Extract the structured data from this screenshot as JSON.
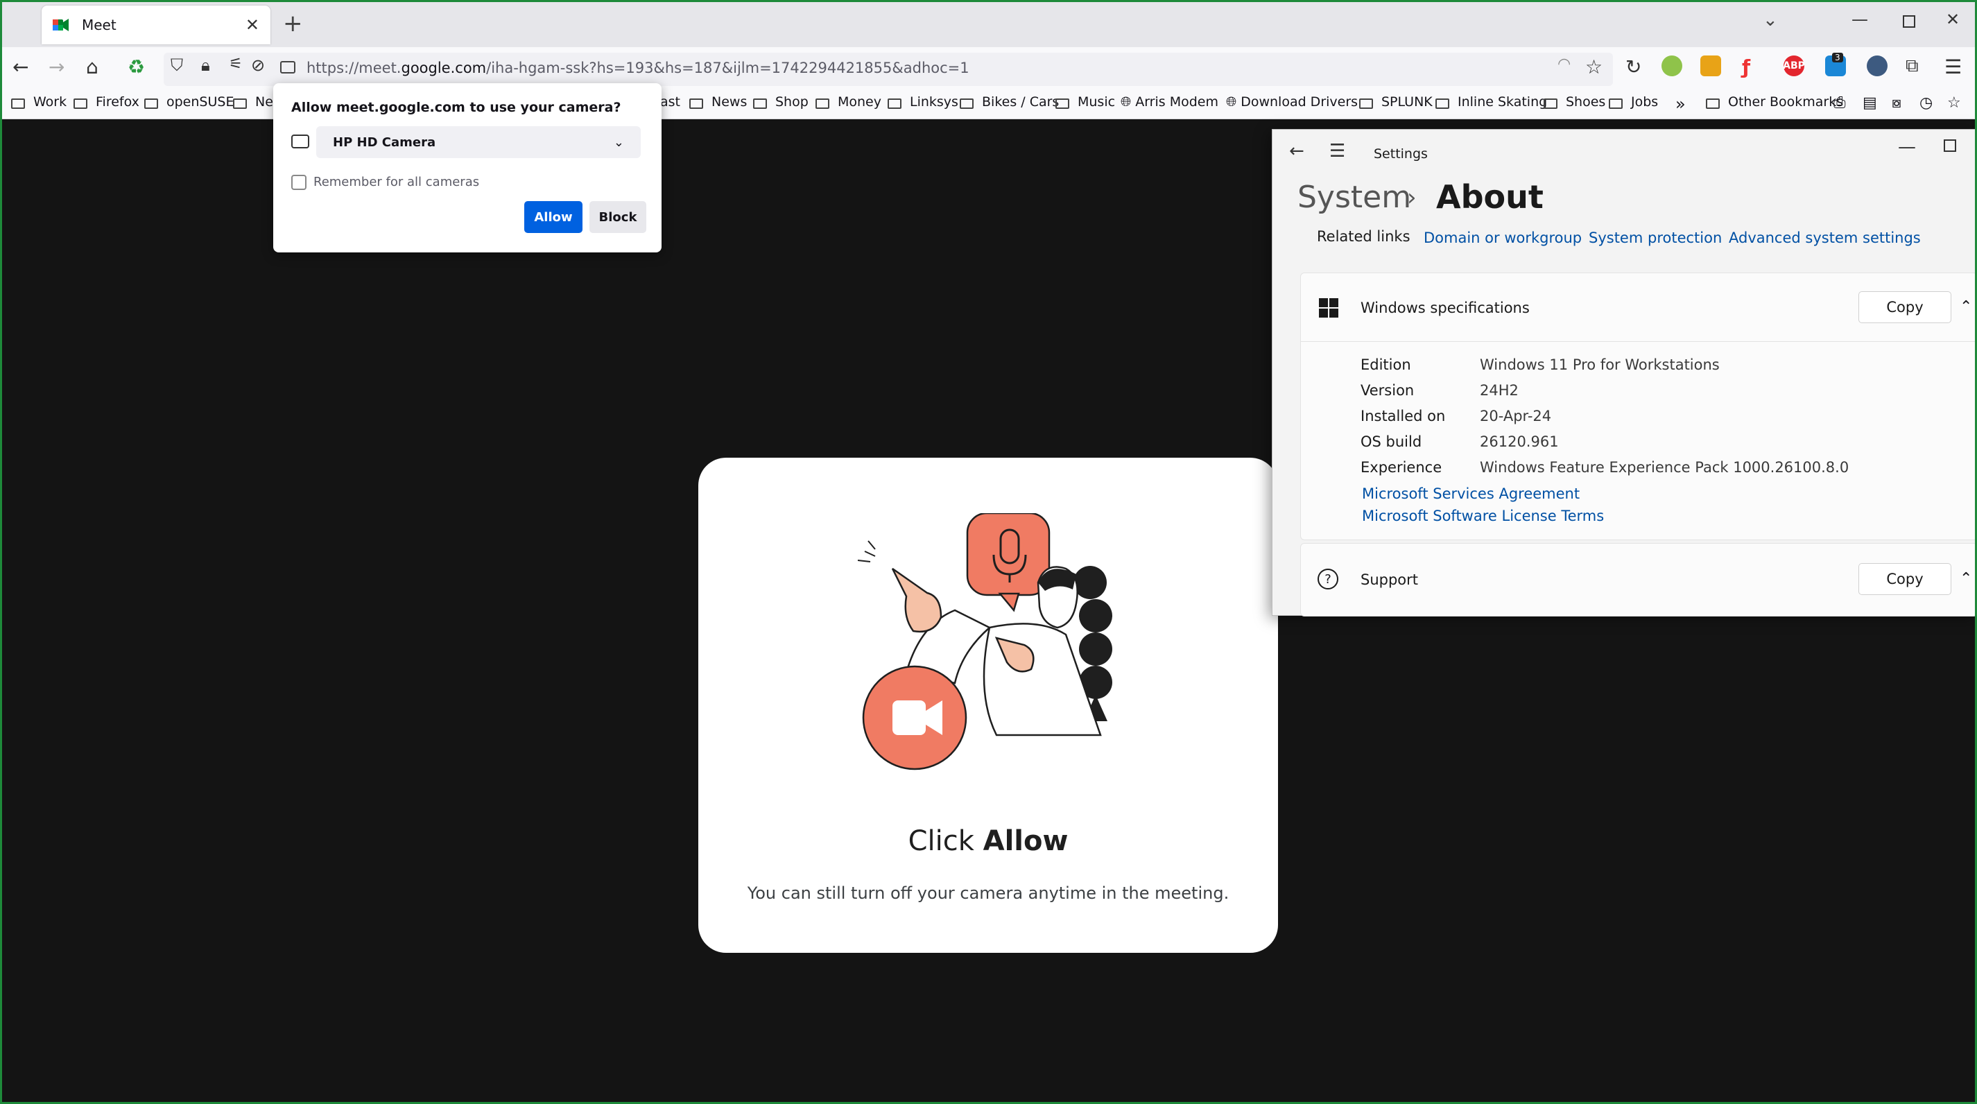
{
  "browser": {
    "tab_title": "Meet",
    "url_prefix": "https://meet.",
    "url_domain": "google.com",
    "url_path": "/iha-hgam-ssk?hs=193&hs=187&ijlm=1742294421855&adhoc=1"
  },
  "bookmarks": [
    "Work",
    "Firefox",
    "openSUSE",
    "Net",
    "ast",
    "News",
    "Shop",
    "Money",
    "Linksys",
    "Bikes / Cars",
    "Music",
    "Arris Modem",
    "Download Drivers",
    "SPLUNK",
    "Inline Skating",
    "Shoes",
    "Jobs",
    "Other Bookmarks"
  ],
  "toolbar": {
    "badge_count": "3",
    "abp_label": "ABP"
  },
  "permission": {
    "question": "Allow meet.google.com to use your camera?",
    "device": "HP HD Camera",
    "remember": "Remember for all cameras",
    "allow": "Allow",
    "block": "Block"
  },
  "card": {
    "title_pre": "Click ",
    "title_bold": "Allow",
    "subtitle": "You can still turn off your camera anytime in the meeting."
  },
  "settings": {
    "window_title": "Settings",
    "breadcrumb_parent": "System",
    "breadcrumb_current": "About",
    "related_links_label": "Related links",
    "related_links": [
      "Domain or workgroup",
      "System protection",
      "Advanced system settings"
    ],
    "windows_spec": {
      "heading": "Windows specifications",
      "copy": "Copy",
      "rows": [
        {
          "key": "Edition",
          "value": "Windows 11 Pro for Workstations"
        },
        {
          "key": "Version",
          "value": "24H2"
        },
        {
          "key": "Installed on",
          "value": "20-Apr-24"
        },
        {
          "key": "OS build",
          "value": "26120.961"
        },
        {
          "key": "Experience",
          "value": "Windows Feature Experience Pack 1000.26100.8.0"
        }
      ],
      "links": [
        "Microsoft Services Agreement",
        "Microsoft Software License Terms"
      ]
    },
    "support": {
      "heading": "Support",
      "copy": "Copy"
    }
  },
  "colors": {
    "accent": "#0061e0",
    "illustration": "#f07b63",
    "frame": "#1e8a3a"
  }
}
